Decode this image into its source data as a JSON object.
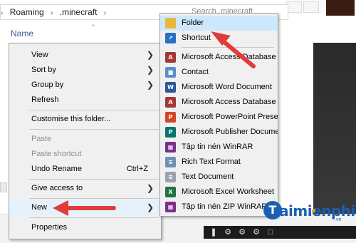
{
  "explorer": {
    "breadcrumb": [
      "Roaming",
      ".minecraft"
    ],
    "search_placeholder": "Search .minecraft",
    "column_header": "Name"
  },
  "context_menu": {
    "items": [
      {
        "label": "View",
        "submenu": true
      },
      {
        "label": "Sort by",
        "submenu": true
      },
      {
        "label": "Group by",
        "submenu": true
      },
      {
        "label": "Refresh"
      },
      {
        "label": "Customise this folder..."
      },
      {
        "label": "Paste",
        "disabled": true
      },
      {
        "label": "Paste shortcut",
        "disabled": true
      },
      {
        "label": "Undo Rename",
        "accel": "Ctrl+Z"
      },
      {
        "label": "Give access to",
        "submenu": true
      },
      {
        "label": "New",
        "submenu": true,
        "highlighted": true
      },
      {
        "label": "Properties"
      }
    ]
  },
  "new_submenu": {
    "items": [
      {
        "label": "Folder",
        "icon": "folder-icon",
        "color": "#e8b83c",
        "highlighted": true
      },
      {
        "label": "Shortcut",
        "icon": "shortcut-icon",
        "color": "#2a6fc4"
      },
      {
        "label": "Microsoft Access Database",
        "icon": "access-icon",
        "color": "#a4373a",
        "glyph": "A"
      },
      {
        "label": "Contact",
        "icon": "contact-icon",
        "color": "#5a8fc8"
      },
      {
        "label": "Microsoft Word Document",
        "icon": "word-icon",
        "color": "#2b579a",
        "glyph": "W"
      },
      {
        "label": "Microsoft Access Database",
        "icon": "access-icon",
        "color": "#a4373a",
        "glyph": "A"
      },
      {
        "label": "Microsoft PowerPoint Presentation",
        "icon": "powerpoint-icon",
        "color": "#d24726",
        "glyph": "P"
      },
      {
        "label": "Microsoft Publisher Document",
        "icon": "publisher-icon",
        "color": "#077568",
        "glyph": "P"
      },
      {
        "label": "Tập tin nén WinRAR",
        "icon": "winrar-icon",
        "color": "#7b2f8a"
      },
      {
        "label": "Rich Text Format",
        "icon": "rtf-icon",
        "color": "#6f8fb5"
      },
      {
        "label": "Text Document",
        "icon": "text-document-icon",
        "color": "#9aa3ad"
      },
      {
        "label": "Microsoft Excel Worksheet",
        "icon": "excel-icon",
        "color": "#217346",
        "glyph": "X"
      },
      {
        "label": "Tập tin nén ZIP WinRAR",
        "icon": "winrar-zip-icon",
        "color": "#7b2f8a"
      }
    ]
  },
  "watermark": {
    "text": "aimienphi",
    "badge": "T",
    "sub": ".vn"
  },
  "colors": {
    "arrow": "#e03c3c",
    "menu_bg": "#f0f0f0",
    "hover": "#cde8fc"
  }
}
